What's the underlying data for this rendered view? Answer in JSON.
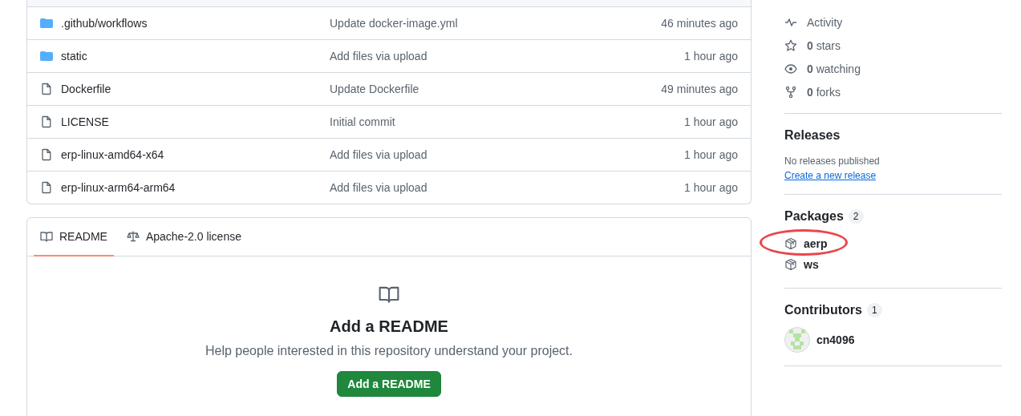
{
  "files": [
    {
      "kind": "folder",
      "name": ".github/workflows",
      "message": "Update docker-image.yml",
      "time": "46 minutes ago"
    },
    {
      "kind": "folder",
      "name": "static",
      "message": "Add files via upload",
      "time": "1 hour ago"
    },
    {
      "kind": "file",
      "name": "Dockerfile",
      "message": "Update Dockerfile",
      "time": "49 minutes ago"
    },
    {
      "kind": "file",
      "name": "LICENSE",
      "message": "Initial commit",
      "time": "1 hour ago"
    },
    {
      "kind": "file",
      "name": "erp-linux-amd64-x64",
      "message": "Add files via upload",
      "time": "1 hour ago"
    },
    {
      "kind": "file",
      "name": "erp-linux-arm64-arm64",
      "message": "Add files via upload",
      "time": "1 hour ago"
    }
  ],
  "readme_tabs": [
    {
      "kind": "book",
      "label": "README",
      "selected": true
    },
    {
      "kind": "law",
      "label": "Apache-2.0 license",
      "selected": false
    }
  ],
  "readme_empty": {
    "heading": "Add a README",
    "text": "Help people interested in this repository understand your project.",
    "button": "Add a README"
  },
  "about_links": [
    {
      "kind": "pulse",
      "label": "Activity"
    },
    {
      "kind": "star",
      "count": "0",
      "label": "stars"
    },
    {
      "kind": "eye",
      "count": "0",
      "label": "watching"
    },
    {
      "kind": "fork",
      "count": "0",
      "label": "forks"
    }
  ],
  "releases": {
    "title": "Releases",
    "note": "No releases published",
    "link": "Create a new release"
  },
  "packages": {
    "title": "Packages",
    "count": "2",
    "items": [
      {
        "name": "aerp",
        "circled": true
      },
      {
        "name": "ws",
        "circled": false
      }
    ]
  },
  "contributors": {
    "title": "Contributors",
    "count": "1",
    "items": [
      {
        "name": "cn4096"
      }
    ]
  }
}
